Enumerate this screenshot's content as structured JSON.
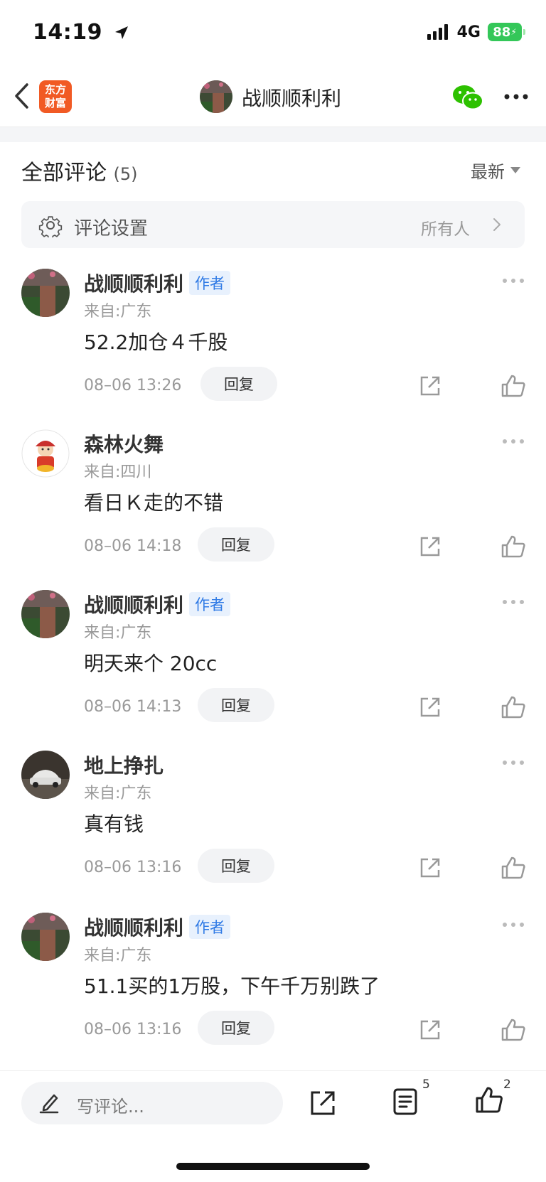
{
  "status_bar": {
    "time": "14:19",
    "network": "4G",
    "battery": "88"
  },
  "nav": {
    "logo_text_line1": "东方",
    "logo_text_line2": "财富",
    "title": "战顺顺利利"
  },
  "comments_header": {
    "title": "全部评论",
    "count": "(5)",
    "sort_label": "最新"
  },
  "comment_settings": {
    "label": "评论设置",
    "value": "所有人"
  },
  "comments": [
    {
      "name": "战顺顺利利",
      "badge": "作者",
      "location": "来自:广东",
      "text": "52.2加仓４千股",
      "time": "08–06 13:26",
      "reply_label": "回复"
    },
    {
      "name": "森林火舞",
      "badge": "",
      "location": "来自:四川",
      "text": "看日Ｋ走的不错",
      "time": "08–06 14:18",
      "reply_label": "回复"
    },
    {
      "name": "战顺顺利利",
      "badge": "作者",
      "location": "来自:广东",
      "text": "明天来个 20cc",
      "time": "08–06 14:13",
      "reply_label": "回复"
    },
    {
      "name": "地上挣扎",
      "badge": "",
      "location": "来自:广东",
      "text": "真有钱",
      "time": "08–06 13:16",
      "reply_label": "回复"
    },
    {
      "name": "战顺顺利利",
      "badge": "作者",
      "location": "来自:广东",
      "text": "51.1买的1万股，下午千万别跌了",
      "time": "08–06 13:16",
      "reply_label": "回复"
    }
  ],
  "bottom_bar": {
    "write_placeholder": "写评论...",
    "comment_count": "5",
    "like_count": "2"
  },
  "colors": {
    "accent_orange": "#f15a24",
    "badge_blue": "#2f7ae5",
    "wechat_green": "#2dc100",
    "battery_green": "#34c759"
  }
}
